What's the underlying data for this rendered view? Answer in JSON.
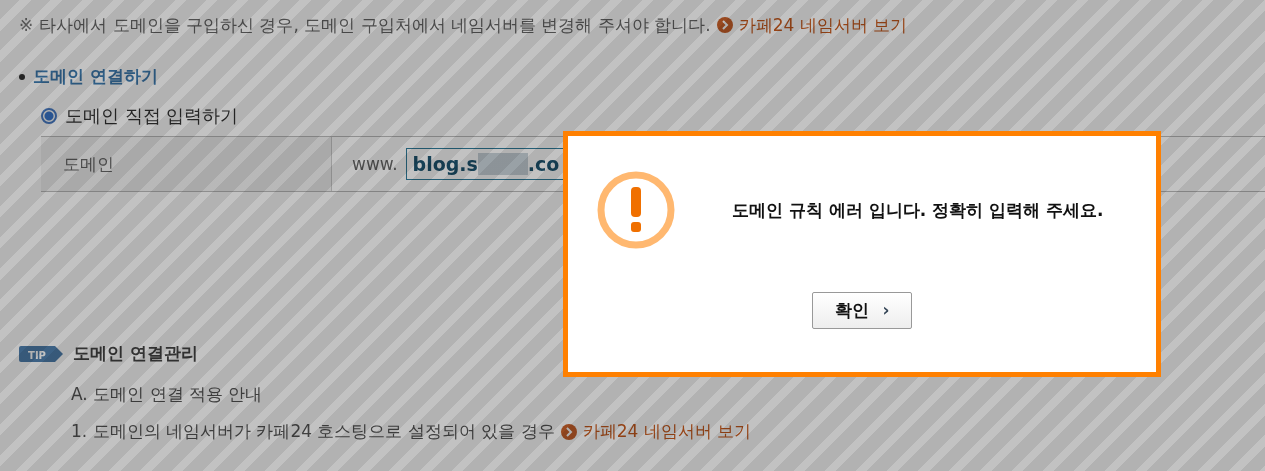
{
  "notice": {
    "mark": "※",
    "text": "타사에서 도메인을 구입하신 경우, 도메인 구입처에서 네임서버를 변경해 주셔야 합니다.",
    "link": "카페24 네임서버 보기"
  },
  "section": {
    "title": "도메인 연결하기",
    "option": {
      "label": "도메인 직접 입력하기",
      "selected": true
    },
    "row": {
      "label": "도메인",
      "prefix": "www.",
      "value_start": "blog.s",
      "value_end": ".co"
    }
  },
  "tip": {
    "badge": "TIP",
    "title": "도메인 연결관리",
    "subtitle": "A. 도메인 연결 적용 안내",
    "item": {
      "text": "1. 도메인의 네임서버가 카페24 호스팅으로 설정되어 있을 경우",
      "link": "카페24 네임서버 보기"
    }
  },
  "dialog": {
    "message": "도메인 규칙 에러 입니다. 정확히 입력해 주세요.",
    "button": "확인",
    "button_icon": "›"
  }
}
